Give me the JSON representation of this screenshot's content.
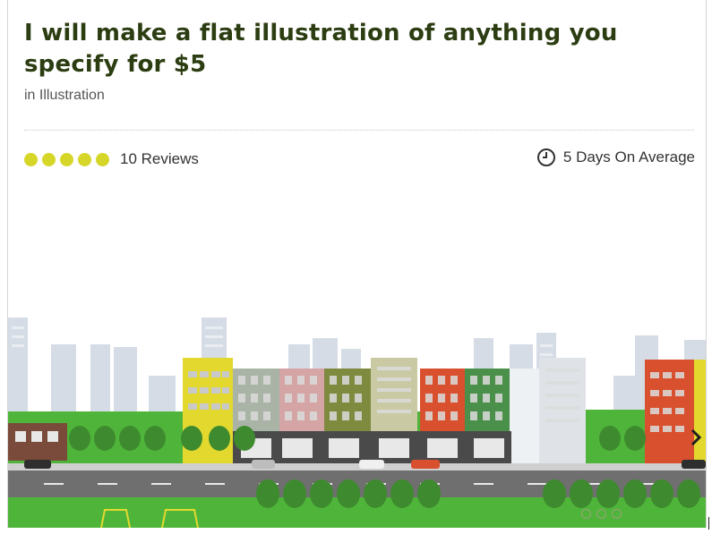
{
  "gig": {
    "title": "I will make a flat illustration of anything you specify for $5",
    "category_prefix": "in",
    "category": "Illustration"
  },
  "rating": {
    "stars": 5,
    "max_stars": 5,
    "reviews_label": "10 Reviews"
  },
  "delivery": {
    "label": "5 Days On Average",
    "icon": "clock-icon"
  },
  "gallery": {
    "image": "flat city street illustration",
    "next_icon": "chevron-right-icon",
    "slide_count": 3
  },
  "colors": {
    "title": "#2c3d12",
    "star": "#d6d629",
    "grass": "#4fb53a",
    "road": "#6f6f6f"
  }
}
